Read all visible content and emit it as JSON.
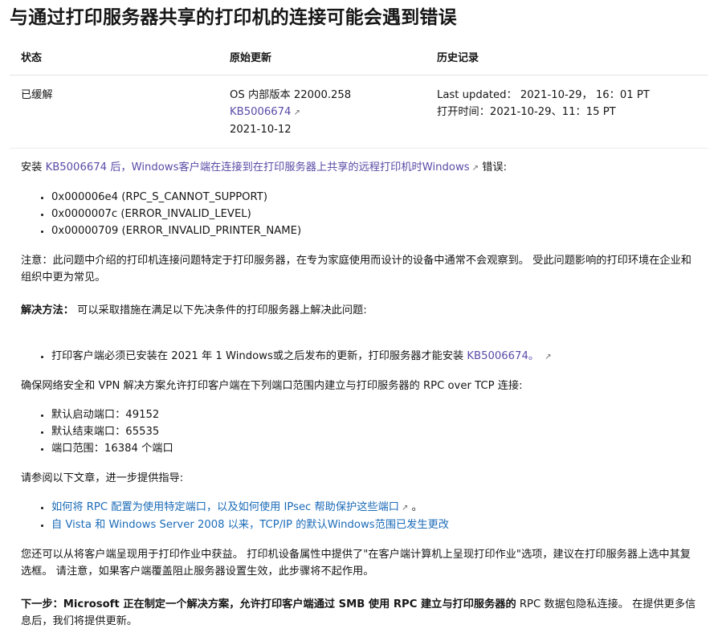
{
  "title": "与通过打印服务器共享的打印机的连接可能会遇到错误",
  "table": {
    "headers": [
      "状态",
      "原始更新",
      "历史记录"
    ],
    "status": "已缓解",
    "orig": {
      "line1": "OS 内部版本 22000.258",
      "kb": "KB5006674",
      "date": "2021-10-12"
    },
    "history": {
      "updated": "Last updated： 2021-10-29， 16：01 PT",
      "opened": "打开时间：2021-10-29、11：15 PT"
    }
  },
  "intro": {
    "pre": "安装 ",
    "link": "KB5006674 后，Windows客户端在连接到在打印服务器上共享的远程打印机时Windows",
    "post": "错误:"
  },
  "errors": [
    "0x000006e4 (RPC_S_CANNOT_SUPPORT)",
    "0x0000007c (ERROR_INVALID_LEVEL)",
    "0x00000709 (ERROR_INVALID_PRINTER_NAME)"
  ],
  "note": "注意：此问题中介绍的打印机连接问题特定于打印服务器，在专为家庭使用而设计的设备中通常不会观察到。 受此问题影响的打印环境在企业和组织中更为常见。",
  "solution": {
    "label": "解决方法：",
    "text": " 可以采取措施在满足以下先决条件的打印服务器上解决此问题:"
  },
  "prereq": {
    "text": "打印客户端必须已安装在 2021 年 1 Windows或之后发布的更新，打印服务器才能安装 ",
    "link": "KB5006674。"
  },
  "vpn": "确保网络安全和 VPN 解决方案允许打印客户端在下列端口范围内建立与打印服务器的 RPC over TCP 连接:",
  "ports": [
    "默认启动端口：49152",
    "默认结束端口：65535",
    "端口范围：16384 个端口"
  ],
  "refer": "请参阅以下文章，进一步提供指导:",
  "articles": [
    {
      "link": "如何将 RPC 配置为使用特定端口，以及如何使用 IPsec 帮助保护这些端口",
      "tail": "。"
    },
    {
      "link": "自 Vista 和 Windows Server 2008 以来，TCP/IP 的默认Windows范围已发生更改",
      "tail": ""
    }
  ],
  "client": "您还可以从将客户端呈现用于打印作业中获益。 打印机设备属性中提供了\"在客户端计算机上呈现打印作业\"选项，建议在打印服务器上选中其复选框。 请注意，如果客户端覆盖阻止服务器设置生效，此步骤将不起作用。",
  "next": {
    "label": "下一步：Microsoft 正在制定一个解决方案，允许打印客户端通过 SMB 使用 RPC 建立与打印服务器的",
    "text": " RPC 数据包隐私连接。 在提供更多信息后，我们将提供更新。"
  },
  "icons": {
    "external": "external-link-icon"
  }
}
